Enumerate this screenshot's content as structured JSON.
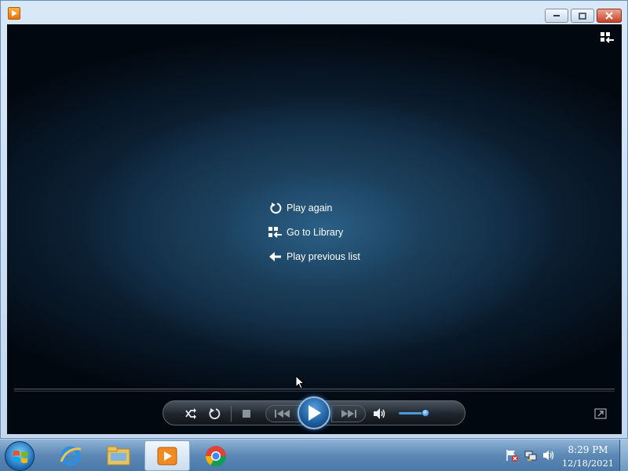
{
  "window": {
    "title_icon": "media-player-icon",
    "caption_buttons": [
      "minimize",
      "maximize",
      "close"
    ]
  },
  "video": {
    "switch_to_library_icon": "switch-to-library-icon",
    "menu": [
      {
        "icon": "replay-icon",
        "label": "Play again"
      },
      {
        "icon": "library-icon",
        "label": "Go to Library"
      },
      {
        "icon": "back-arrow-icon",
        "label": "Play previous list"
      }
    ]
  },
  "controls": {
    "shuffle_icon": "shuffle-icon",
    "repeat_icon": "repeat-icon",
    "stop_icon": "stop-icon",
    "previous_icon": "previous-icon",
    "play_icon": "play-icon",
    "next_icon": "next-icon",
    "mute_icon": "speaker-icon",
    "volume_level": 0.5,
    "fullscreen_icon": "fullscreen-icon"
  },
  "taskbar": {
    "apps": [
      "internet-explorer-icon",
      "windows-explorer-icon",
      "windows-media-player-icon",
      "chrome-icon"
    ],
    "active_app": "windows-media-player-icon",
    "tray_icons": [
      "action-center-flag-icon",
      "network-icon",
      "volume-icon"
    ],
    "clock": {
      "time": "8:29 PM",
      "date": "12/18/2021"
    }
  },
  "colors": {
    "accent": "#1b5d9e",
    "video_background": "#0d2236",
    "taskbar": "#5b88b5"
  }
}
